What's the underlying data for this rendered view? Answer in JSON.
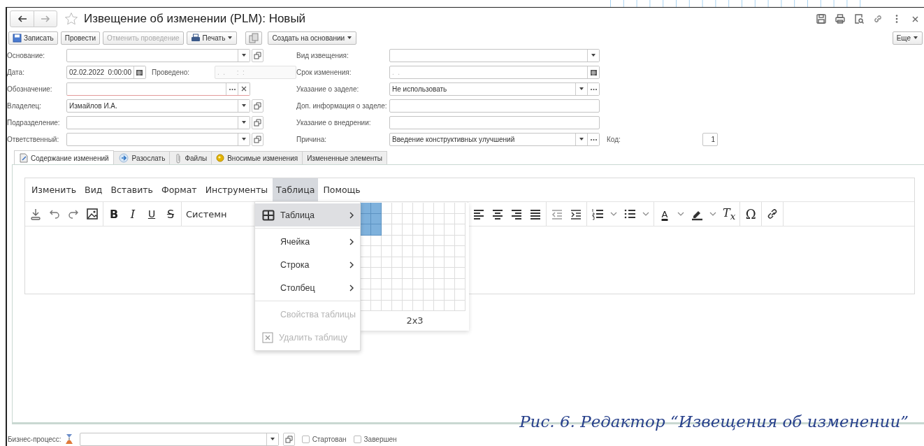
{
  "window": {
    "title": "Извещение об изменении (PLM): Новый",
    "favorite": false
  },
  "nav": [
    {
      "kind": "back",
      "disabled": false
    },
    {
      "kind": "forward",
      "disabled": true
    }
  ],
  "toolbar": [
    {
      "kind": "save",
      "label": "Записать",
      "disabled": false,
      "dropdown": false
    },
    {
      "kind": "plain",
      "label": "Провести",
      "disabled": false,
      "dropdown": false
    },
    {
      "kind": "plain",
      "label": "Отменить проведение",
      "disabled": true,
      "dropdown": false
    },
    {
      "kind": "print",
      "label": "Печать",
      "disabled": false,
      "dropdown": true
    },
    {
      "kind": "copy",
      "disabled": false,
      "dropdown": false
    },
    {
      "kind": "plain",
      "label": "Создать на основании",
      "disabled": false,
      "dropdown": true
    }
  ],
  "more_button": {
    "label": "Еще"
  },
  "left_fields": [
    {
      "kind": "reference",
      "label": "Основание:",
      "required": false
    },
    {
      "kind": "date",
      "label": "Дата:",
      "value": "02.02.2022  0:00:00",
      "required": false,
      "posted": {
        "label": "Проведено:",
        "placeholder": ".  .      :  :"
      }
    },
    {
      "kind": "choose_clear",
      "label": "Обозначение:",
      "required": true
    },
    {
      "kind": "reference",
      "label": "Владелец:",
      "value": "Измайлов И.А.",
      "required": false
    },
    {
      "kind": "reference",
      "label": "Подразделение:",
      "required": false
    },
    {
      "kind": "reference",
      "label": "Ответственный:",
      "required": false
    }
  ],
  "right_fields": [
    {
      "kind": "select",
      "label": "Вид извещения:"
    },
    {
      "kind": "date",
      "label": "Срок изменения:",
      "placeholder": ".  ."
    },
    {
      "kind": "select_choose",
      "label": "Указание о заделе:",
      "value": "Не использовать"
    },
    {
      "kind": "text",
      "label": "Доп. информация о заделе:"
    },
    {
      "kind": "text",
      "label": "Указание о внедрении:"
    },
    {
      "kind": "select_choose",
      "label": "Причина:",
      "value": "Введение конструктивных улучшений",
      "code": {
        "label": "Код:",
        "value": "1"
      }
    }
  ],
  "tabs": [
    {
      "kind": "document",
      "label": "Содержание изменений",
      "selected": true
    },
    {
      "kind": "send",
      "label": "Разослать",
      "selected": false
    },
    {
      "kind": "clip",
      "label": "Файлы",
      "selected": false
    },
    {
      "kind": "bulb",
      "label": "Вносимые изменения",
      "selected": false
    },
    {
      "kind": "none",
      "label": "Измененные элементы",
      "selected": false
    }
  ],
  "editor": {
    "menu": [
      {
        "label": "Изменить",
        "selected": false
      },
      {
        "label": "Вид",
        "selected": false
      },
      {
        "label": "Вставить",
        "selected": false
      },
      {
        "label": "Формат",
        "selected": false
      },
      {
        "label": "Инструменты",
        "selected": false
      },
      {
        "label": "Таблица",
        "selected": true
      },
      {
        "label": "Помощь",
        "selected": false
      }
    ],
    "tool_groups": [
      [
        {
          "kind": "download"
        },
        {
          "kind": "undo"
        },
        {
          "kind": "redo"
        },
        {
          "kind": "image"
        }
      ],
      [
        {
          "kind": "bold",
          "text": "B"
        },
        {
          "kind": "italic",
          "text": "I"
        },
        {
          "kind": "underline",
          "text": "U"
        },
        {
          "kind": "strike",
          "text": "S"
        }
      ],
      [
        {
          "kind": "font",
          "text": "Системн"
        }
      ],
      [
        {
          "kind": "align-left"
        },
        {
          "kind": "align-center"
        },
        {
          "kind": "align-right"
        },
        {
          "kind": "justify"
        }
      ],
      [
        {
          "kind": "outdent"
        },
        {
          "kind": "indent"
        }
      ],
      [
        {
          "kind": "numlist"
        },
        {
          "kind": "caret"
        },
        {
          "kind": "bullist"
        },
        {
          "kind": "caret"
        }
      ],
      [
        {
          "kind": "text-color",
          "text": "A"
        },
        {
          "kind": "caret"
        },
        {
          "kind": "highlight"
        },
        {
          "kind": "caret"
        },
        {
          "kind": "clear-format",
          "text": "T$_{x}$"
        }
      ],
      [
        {
          "kind": "special-char",
          "text": "Ω"
        }
      ],
      [
        {
          "kind": "link"
        }
      ]
    ],
    "dropdown": [
      {
        "kind": "table",
        "label": "Таблица",
        "submenu": true,
        "selected": true,
        "disabled": false,
        "separator_before": false
      },
      {
        "kind": "none",
        "label": "Ячейка",
        "submenu": true,
        "selected": false,
        "disabled": false,
        "separator_before": true
      },
      {
        "kind": "none",
        "label": "Строка",
        "submenu": true,
        "selected": false,
        "disabled": false,
        "separator_before": false
      },
      {
        "kind": "none",
        "label": "Столбец",
        "submenu": true,
        "selected": false,
        "disabled": false,
        "separator_before": false
      },
      {
        "kind": "none",
        "label": "Свойства таблицы",
        "submenu": false,
        "selected": false,
        "disabled": true,
        "separator_before": true
      },
      {
        "kind": "delete",
        "label": "Удалить таблицу",
        "submenu": false,
        "selected": false,
        "disabled": true,
        "separator_before": false
      }
    ],
    "grid_picker": {
      "label": "2x3",
      "cells": [
        [
          true,
          true,
          false,
          false,
          false,
          false,
          false,
          false,
          false,
          false
        ],
        [
          true,
          true,
          false,
          false,
          false,
          false,
          false,
          false,
          false,
          false
        ],
        [
          true,
          true,
          false,
          false,
          false,
          false,
          false,
          false,
          false,
          false
        ],
        [
          false,
          false,
          false,
          false,
          false,
          false,
          false,
          false,
          false,
          false
        ],
        [
          false,
          false,
          false,
          false,
          false,
          false,
          false,
          false,
          false,
          false
        ],
        [
          false,
          false,
          false,
          false,
          false,
          false,
          false,
          false,
          false,
          false
        ],
        [
          false,
          false,
          false,
          false,
          false,
          false,
          false,
          false,
          false,
          false
        ],
        [
          false,
          false,
          false,
          false,
          false,
          false,
          false,
          false,
          false,
          false
        ],
        [
          false,
          false,
          false,
          false,
          false,
          false,
          false,
          false,
          false,
          false
        ],
        [
          false,
          false,
          false,
          false,
          false,
          false,
          false,
          false,
          false,
          false
        ]
      ]
    }
  },
  "business_process": {
    "label": "Бизнес-процесс:",
    "checks": [
      {
        "label": "Стартован",
        "checked": false
      },
      {
        "label": "Завершен",
        "checked": false
      }
    ]
  },
  "caption": "Рис. 6. Редактор “Извещения об изменении”"
}
